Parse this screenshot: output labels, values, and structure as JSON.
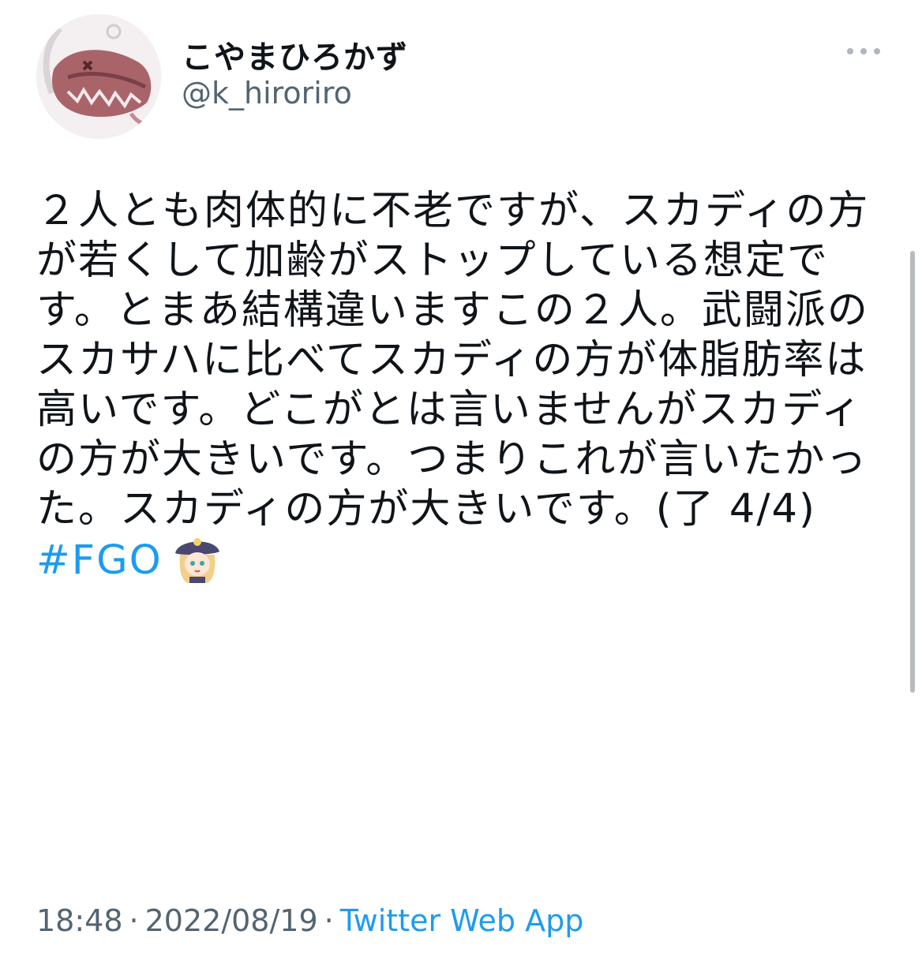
{
  "author": {
    "display_name": "こやまひろかず",
    "handle": "@k_hiroriro"
  },
  "tweet": {
    "text": "２人とも肉体的に不老ですが、スカディの方が若くして加齢がストップしている想定です。とまあ結構違いますこの２人。武闘派のスカサハに比べてスカディの方が体脂肪率は高いです。どこがとは言いませんがスカディの方が大きいです。つまりこれが言いたかった。スカディの方が大きいです。(了 4/4) ",
    "hashtag": "#FGO"
  },
  "meta": {
    "time": "18:48",
    "separator": "·",
    "date": "2022/08/19",
    "source": "Twitter Web App"
  },
  "icons": {
    "more": "more-horizontal-icon",
    "avatar": "avatar-image",
    "emoji": "character-emoji-icon"
  },
  "colors": {
    "link": "#1d9bf0",
    "secondary": "#536471",
    "text": "#0f1419"
  }
}
